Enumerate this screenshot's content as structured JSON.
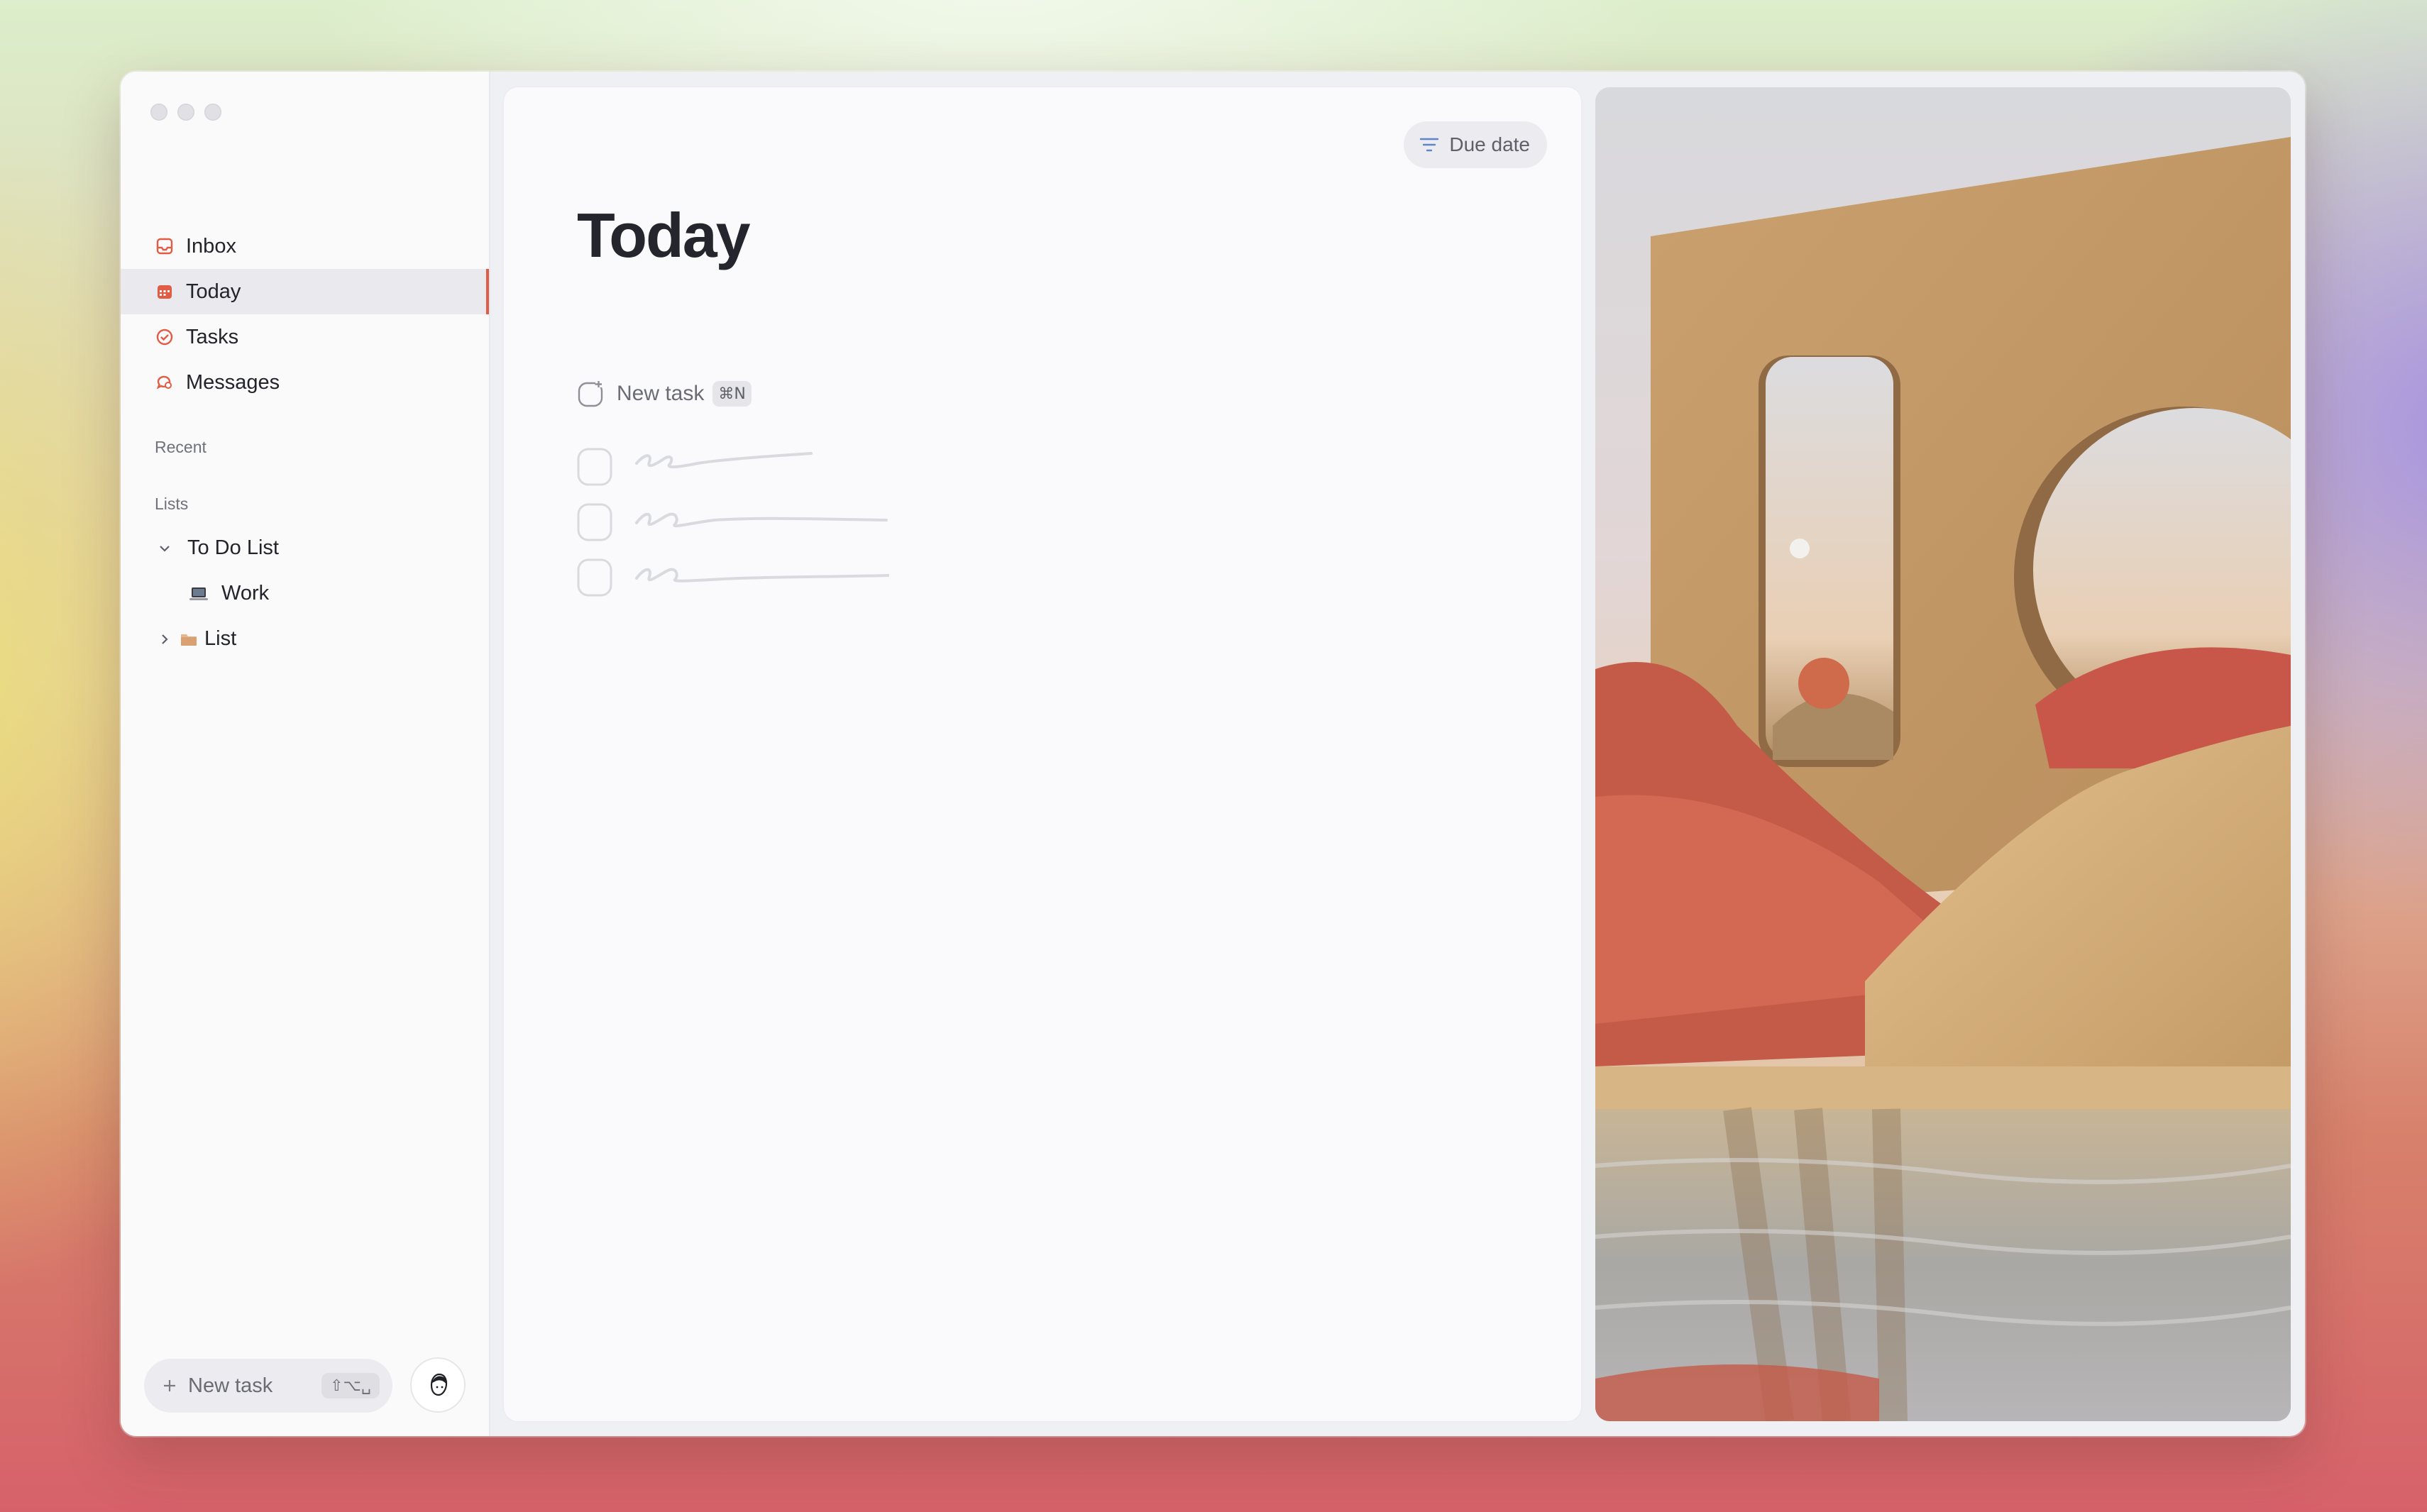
{
  "sidebar": {
    "nav": [
      {
        "label": "Inbox",
        "icon": "inbox-icon",
        "active": false
      },
      {
        "label": "Today",
        "icon": "calendar-icon",
        "active": true
      },
      {
        "label": "Tasks",
        "icon": "tasks-icon",
        "active": false
      },
      {
        "label": "Messages",
        "icon": "messages-icon",
        "active": false
      }
    ],
    "recent_label": "Recent",
    "lists_label": "Lists",
    "lists": [
      {
        "label": "To Do List",
        "expanded": true,
        "children": [
          {
            "label": "Work",
            "icon": "laptop-icon"
          }
        ]
      },
      {
        "label": "List",
        "expanded": false,
        "icon": "folder-icon"
      }
    ],
    "new_task_label": "New task",
    "new_task_shortcut": "⇧⌥␣"
  },
  "main": {
    "filter_label": "Due date",
    "title": "Today",
    "new_task_label": "New task",
    "new_task_shortcut": "⌘N"
  },
  "colors": {
    "accent": "#e25b45",
    "text": "#23242a",
    "muted": "#6b6c75"
  }
}
